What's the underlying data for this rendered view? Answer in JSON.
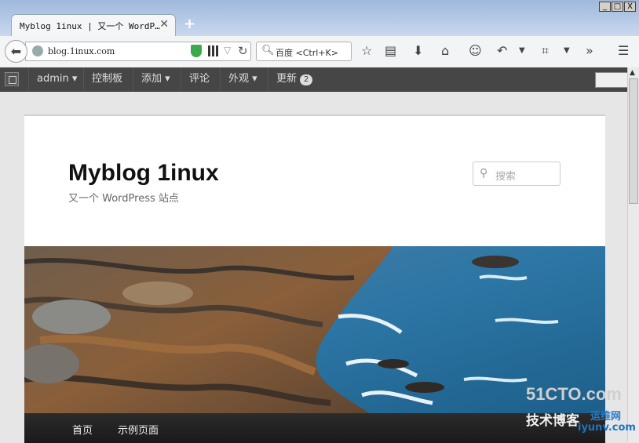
{
  "browser": {
    "tab_title": "Myblog 1inux | 又一个 WordP…",
    "tab_close": "✕",
    "new_tab": "+",
    "url": "blog.1inux.com",
    "search_placeholder": "百度 <Ctrl+K>",
    "window_controls": [
      "_",
      "□",
      "X"
    ]
  },
  "admin_bar": {
    "items": [
      {
        "label": "admin",
        "dropdown": true
      },
      {
        "label": "控制板",
        "dropdown": false
      },
      {
        "label": "添加",
        "dropdown": true
      },
      {
        "label": "评论",
        "dropdown": false
      },
      {
        "label": "外观",
        "dropdown": true
      },
      {
        "label": "更新",
        "dropdown": false
      }
    ],
    "update_count": "2"
  },
  "site": {
    "title": "Myblog 1inux",
    "description": "又一个 WordPress 站点",
    "search_placeholder": "搜索"
  },
  "nav": {
    "items": [
      "首页",
      "示例页面"
    ]
  },
  "watermark": {
    "brand": "51CTO.com",
    "subtitle": "技术博客",
    "site": "iyunv.com",
    "tag": "运维网"
  },
  "colors": {
    "accent_green": "#3caa4c",
    "admin_bar": "#464646"
  }
}
